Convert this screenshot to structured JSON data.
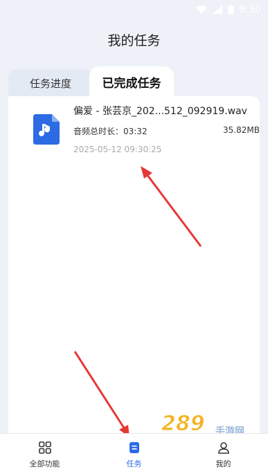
{
  "status": {
    "time": "9:30"
  },
  "header": {
    "title": "我的任务"
  },
  "tabs": [
    {
      "label": "任务进度",
      "active": false
    },
    {
      "label": "已完成任务",
      "active": true
    }
  ],
  "task": {
    "file_name": "偏爱 - 张芸京_202...512_092919.wav",
    "duration_label": "音频总时长：03:32",
    "size": "35.82MB",
    "timestamp": "2025-05-12 09:30:25",
    "icon": "music-file-icon"
  },
  "bottom_nav": [
    {
      "label": "全部功能",
      "icon": "grid-icon",
      "active": false
    },
    {
      "label": "任务",
      "icon": "task-icon",
      "active": true
    },
    {
      "label": "我的",
      "icon": "user-icon",
      "active": false
    }
  ],
  "watermark": {
    "text": "289",
    "suffix": "手游网"
  },
  "colors": {
    "accent": "#2d6be4",
    "arrow": "#e53935",
    "background": "#eef2f8"
  }
}
